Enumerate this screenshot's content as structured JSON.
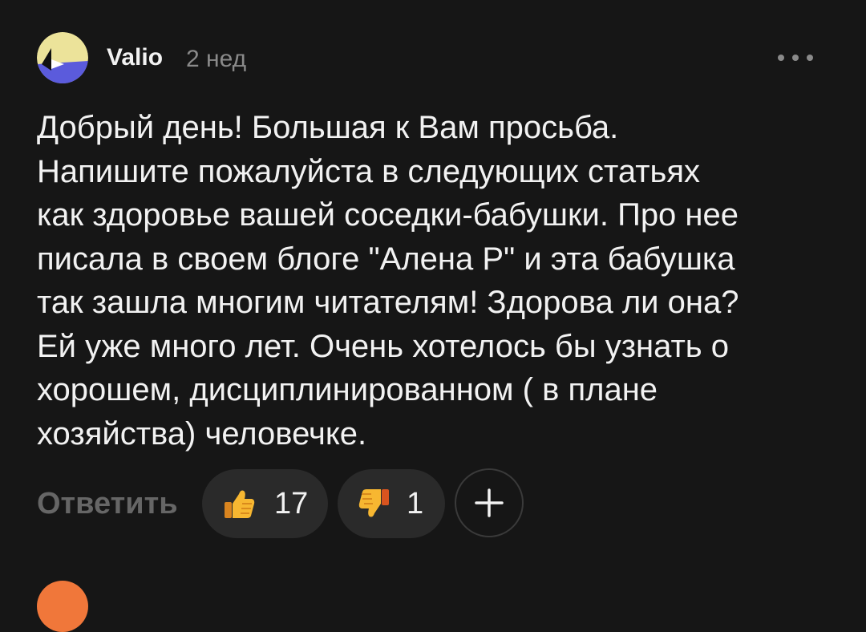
{
  "comment": {
    "author": "Valio",
    "time": "2 нед",
    "text_lines": [
      "Добрый день! Большая к Вам просьба.",
      "Напишите пожалуйста в следующих статьях",
      "как здоровье вашей соседки-бабушки. Про нее",
      "писала в своем блоге \"Алена Р\" и эта бабушка",
      "так зашла многим читателям! Здорова ли она?",
      "Ей уже много лет. Очень хотелось бы узнать о",
      "хорошем, дисциплинированном ( в плане",
      "хозяйства) человечке."
    ],
    "actions": {
      "reply_label": "Ответить",
      "likes": "17",
      "dislikes": "1"
    }
  },
  "icons": {
    "more": "more-dots-icon",
    "like": "thumbs-up-icon",
    "dislike": "thumbs-down-icon",
    "add": "plus-icon"
  },
  "colors": {
    "background": "#161616",
    "pill": "#2a2a2a",
    "secondary_text": "#8a8a8a",
    "next_avatar": "#f0773a"
  }
}
